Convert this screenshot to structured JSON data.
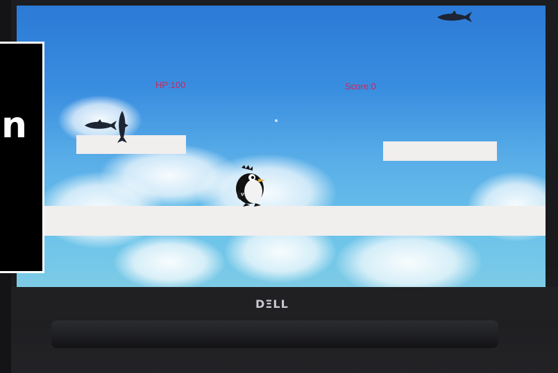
{
  "hud": {
    "hp": "HP:100",
    "score": "Score:0"
  },
  "overlay": {
    "partial_text": "n"
  },
  "device": {
    "brand_logo": "DΞLL"
  },
  "colors": {
    "hud_text": "#d0245a",
    "sky_top": "#2b7ad6",
    "sky_bottom": "#7dcbe6",
    "platform": "#f1eeee"
  },
  "sprites": {
    "player": "penguin-icon",
    "enemy": "shark-icon"
  }
}
